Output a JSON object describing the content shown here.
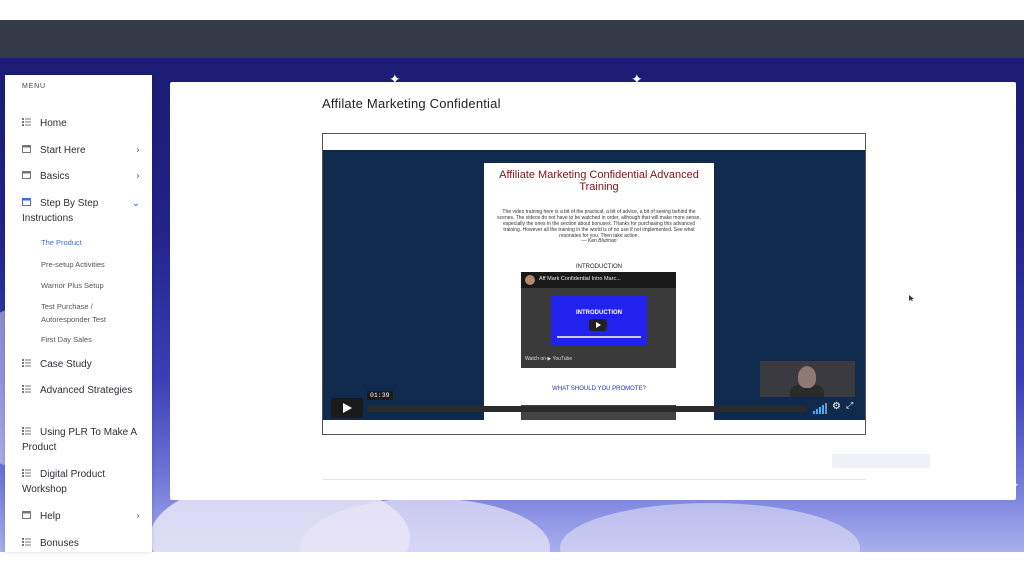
{
  "sidebar": {
    "menu_title": "MENU",
    "items": [
      {
        "label": "Home",
        "has_chevron": false
      },
      {
        "label": "Start Here",
        "has_chevron": true
      },
      {
        "label": "Basics",
        "has_chevron": true
      },
      {
        "label": "Step By Step Instructions",
        "has_chevron": true,
        "expanded": true
      },
      {
        "label": "Case Study",
        "has_chevron": false
      },
      {
        "label": "Advanced Strategies",
        "has_chevron": false
      },
      {
        "label": "Using PLR To Make A Product",
        "has_chevron": false
      },
      {
        "label": "Digital Product Workshop",
        "has_chevron": false
      },
      {
        "label": "Help",
        "has_chevron": true
      },
      {
        "label": "Bonuses",
        "has_chevron": false
      }
    ],
    "sub_items": [
      {
        "label": "The Product",
        "active": true
      },
      {
        "label": "Pre-setup Activities",
        "active": false
      },
      {
        "label": "Warrior Plus Setup",
        "active": false
      },
      {
        "label": "Test Purchase / Autoresponder Test",
        "active": false
      },
      {
        "label": "First Day Sales",
        "active": false
      }
    ]
  },
  "main": {
    "title": "Affilate Marketing Confidential",
    "video": {
      "doc_title": "Affiliate Marketing Confidential Advanced Training",
      "doc_body": "The video training here is a bit of the practical, a bit of advice, a bit of seeing behind the scenes. The videos do not have to be watched in order, although that will make more sense, especially the ones in the section about bonuses. Thanks for purchasing this advanced training. However all the training in the world is of no use if not implemented. See what resonates for you. Then take action.",
      "doc_quote": "— Ken Blutman",
      "intro_heading": "INTRODUCTION",
      "yt_title": "Aff Mark Confidential Intro Marc...",
      "yt_card_text": "INTRODUCTION",
      "yt_watch": "Watch on ▶ YouTube",
      "what_heading": "WHAT SHOULD YOU PROMOTE?",
      "current_time": "01:39",
      "volume_level": 0.8
    }
  },
  "colors": {
    "topbar": "#343b48",
    "backdrop": "#22228a",
    "active_link": "#3b6fd8",
    "video_bg": "#0f2a4c"
  }
}
